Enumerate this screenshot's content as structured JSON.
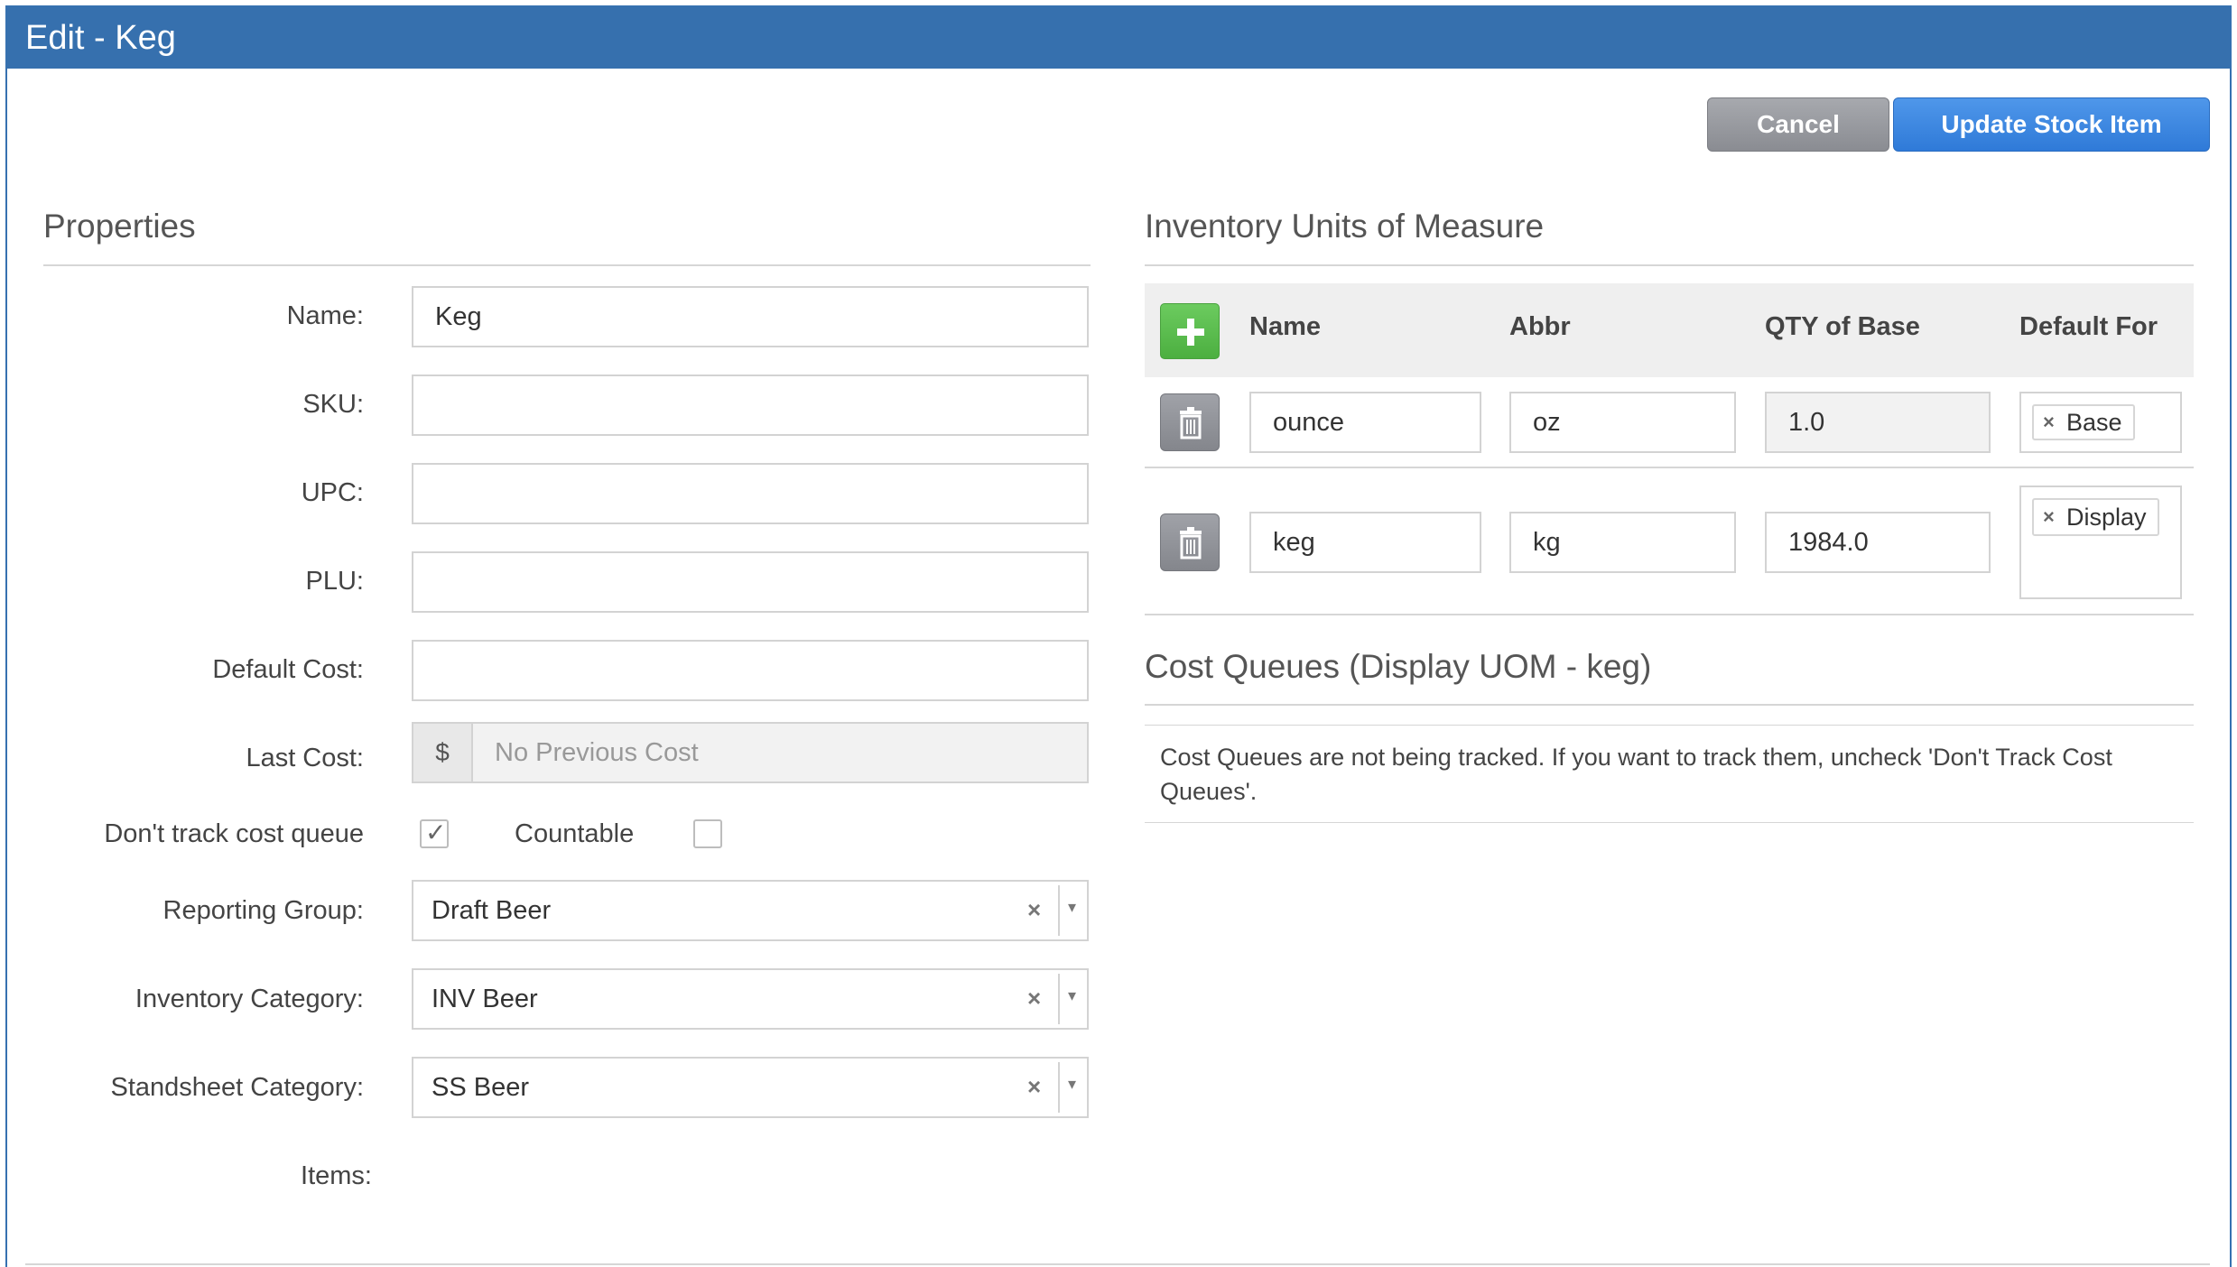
{
  "window": {
    "title": "Edit - Keg"
  },
  "toolbar": {
    "cancel_label": "Cancel",
    "update_label": "Update Stock Item"
  },
  "properties": {
    "title": "Properties",
    "name": {
      "label": "Name:",
      "value": "Keg"
    },
    "sku": {
      "label": "SKU:",
      "value": ""
    },
    "upc": {
      "label": "UPC:",
      "value": ""
    },
    "plu": {
      "label": "PLU:",
      "value": ""
    },
    "default_cost": {
      "label": "Default Cost:",
      "value": ""
    },
    "last_cost": {
      "label": "Last Cost:",
      "currency": "$",
      "placeholder": "No Previous Cost"
    },
    "dont_track": {
      "label": "Don't track cost queue",
      "checked": true
    },
    "countable": {
      "label": "Countable",
      "checked": false
    },
    "reporting_group": {
      "label": "Reporting Group:",
      "value": "Draft Beer"
    },
    "inventory_category": {
      "label": "Inventory Category:",
      "value": "INV Beer"
    },
    "standsheet_category": {
      "label": "Standsheet Category:",
      "value": "SS Beer"
    },
    "items": {
      "label": "Items:"
    }
  },
  "uom": {
    "title": "Inventory Units of Measure",
    "columns": {
      "name": "Name",
      "abbr": "Abbr",
      "qty": "QTY of Base",
      "default_for": "Default For"
    },
    "rows": [
      {
        "name": "ounce",
        "abbr": "oz",
        "qty": "1.0",
        "default_for": "Base"
      },
      {
        "name": "keg",
        "abbr": "kg",
        "qty": "1984.0",
        "default_for": "Display"
      }
    ]
  },
  "cost_queues": {
    "title": "Cost Queues (Display UOM - keg)",
    "message": "Cost Queues are not being tracked. If you want to track them, uncheck 'Don't Track Cost Queues'."
  },
  "icons": {
    "clear": "×",
    "dropdown": "▾",
    "check": "✓",
    "plus": "plus-icon",
    "trash": "trash-icon"
  },
  "colors": {
    "title_bar": "#3670ae",
    "primary_button": "#2f7ad8",
    "add_button": "#4caf40",
    "cancel_button": "#8a8c92"
  }
}
